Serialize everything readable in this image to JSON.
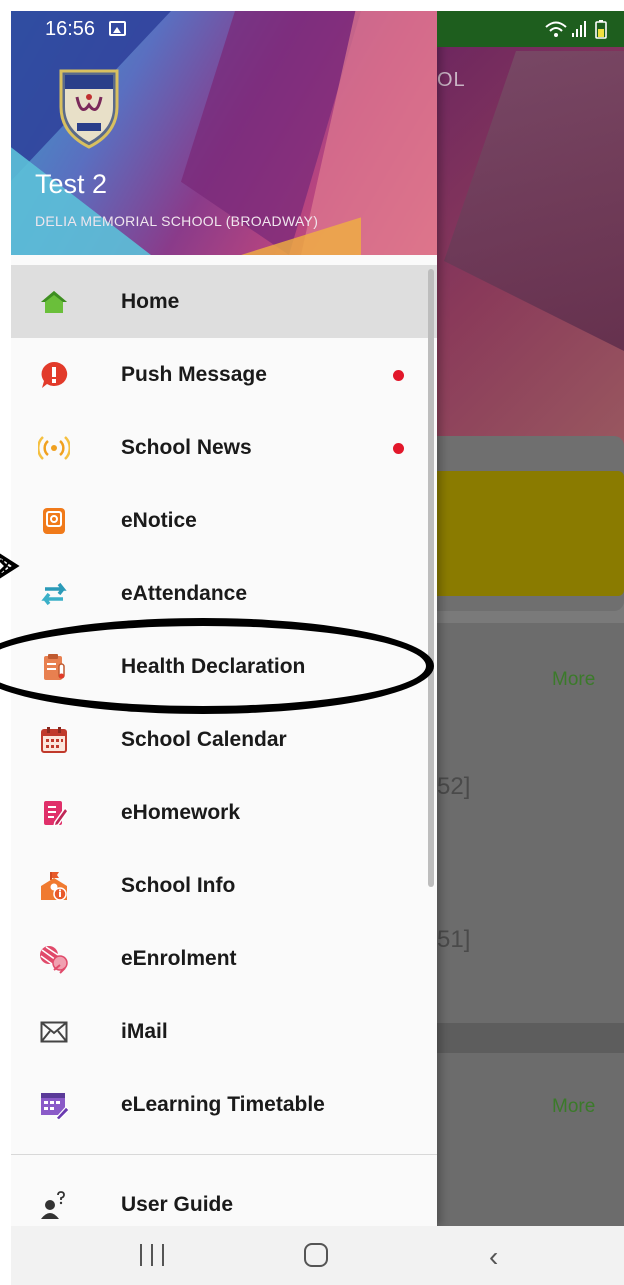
{
  "status_bar": {
    "time": "16:56"
  },
  "background": {
    "title_fragment": "OL",
    "more_1": "More",
    "text_1": "52]",
    "text_2": "51]",
    "more_2": "More"
  },
  "drawer": {
    "user_name": "Test 2",
    "school_name": "DELIA MEMORIAL SCHOOL (BROADWAY)",
    "items": [
      {
        "label": "Home",
        "icon": "home-icon",
        "active": true,
        "badge": false
      },
      {
        "label": "Push Message",
        "icon": "push-message-icon",
        "badge": true
      },
      {
        "label": "School News",
        "icon": "school-news-icon",
        "badge": true
      },
      {
        "label": "eNotice",
        "icon": "enotice-icon",
        "badge": false
      },
      {
        "label": "eAttendance",
        "icon": "eattendance-icon",
        "badge": false
      },
      {
        "label": "Health Declaration",
        "icon": "health-declaration-icon",
        "badge": false
      },
      {
        "label": "School Calendar",
        "icon": "calendar-icon",
        "badge": false
      },
      {
        "label": "eHomework",
        "icon": "ehomework-icon",
        "badge": false
      },
      {
        "label": "School Info",
        "icon": "school-info-icon",
        "badge": false
      },
      {
        "label": "eEnrolment",
        "icon": "eenrolment-icon",
        "badge": false
      },
      {
        "label": "iMail",
        "icon": "mail-icon",
        "badge": false
      },
      {
        "label": "eLearning Timetable",
        "icon": "timetable-icon",
        "badge": false
      }
    ],
    "footer_item": {
      "label": "User Guide",
      "icon": "user-guide-icon"
    }
  },
  "colors": {
    "badge": "#e2172a",
    "active_bg": "#dedede",
    "status_bar_green": "#1e5e1e",
    "more_link": "#3b7a2a"
  }
}
